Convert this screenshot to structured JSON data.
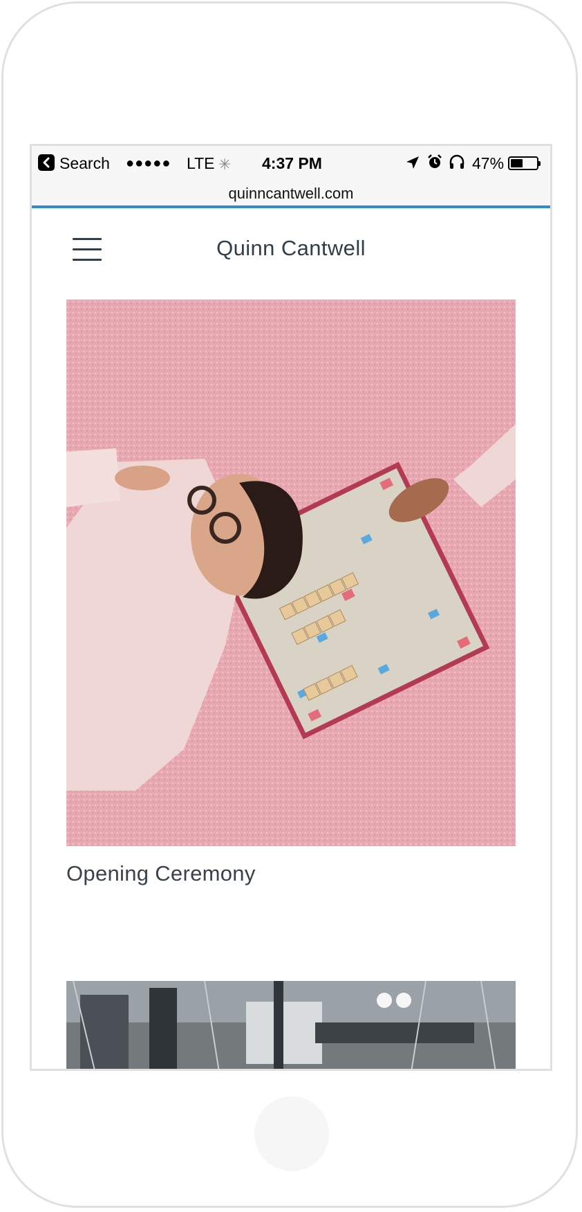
{
  "status_bar": {
    "back_label": "Search",
    "signal": "●●●●●",
    "network": "LTE",
    "time": "4:37 PM",
    "battery_percent_text": "47%",
    "battery_level": 0.47
  },
  "browser": {
    "url": "quinncantwell.com"
  },
  "site": {
    "title": "Quinn Cantwell",
    "menu_icon": "hamburger-icon"
  },
  "projects": [
    {
      "caption": "Opening Ceremony",
      "image": "woman-on-pink-rug-with-scrabble-board"
    },
    {
      "caption": "",
      "image": "studio-equipment-photo"
    }
  ],
  "colors": {
    "accent": "#2d8ccd",
    "title_text": "#2f3e4a",
    "caption_text": "#3a4149",
    "rug_pink": "#e6a6b0"
  }
}
